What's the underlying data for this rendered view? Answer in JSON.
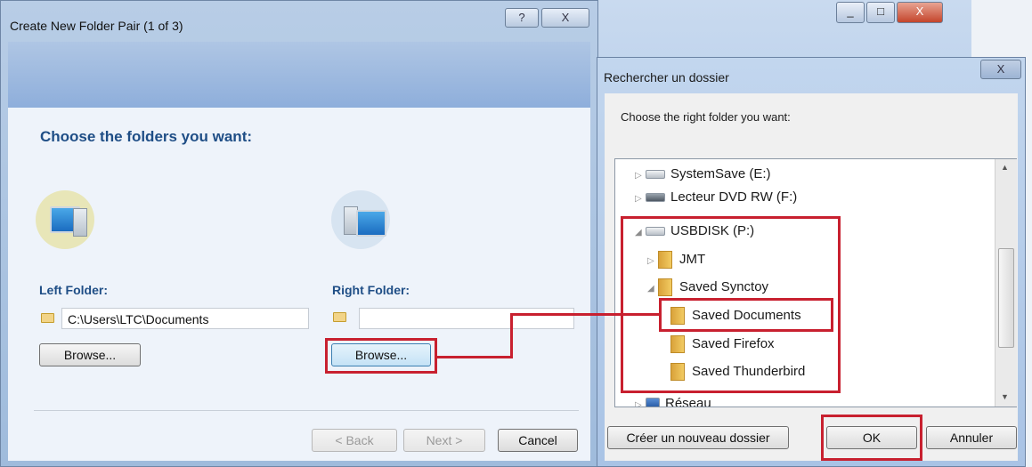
{
  "main_dialog": {
    "title": "Create New Folder Pair (1 of 3)",
    "help_symbol": "?",
    "close_symbol": "X",
    "heading": "Choose the folders you want:",
    "left_folder": {
      "label": "Left Folder:",
      "path": "C:\\Users\\LTC\\Documents",
      "browse_label": "Browse..."
    },
    "right_folder": {
      "label": "Right Folder:",
      "path": "",
      "browse_label": "Browse..."
    },
    "footer": {
      "back_label": "< Back",
      "next_label": "Next >",
      "cancel_label": "Cancel"
    }
  },
  "background_window": {
    "minimize_symbol": "_",
    "maximize_symbol": "□",
    "close_symbol": "X"
  },
  "browse_dialog": {
    "title": "Rechercher un dossier",
    "close_symbol": "X",
    "prompt": "Choose the right folder you want:",
    "tree": [
      {
        "label": "SystemSave (E:)",
        "type": "drive",
        "expand": "▷"
      },
      {
        "label": "Lecteur DVD RW (F:)",
        "type": "dvd",
        "expand": "▷"
      },
      {
        "label": "USBDISK (P:)",
        "type": "drive",
        "expand": "◢"
      },
      {
        "label": "JMT",
        "type": "folder",
        "expand": "▷"
      },
      {
        "label": "Saved Synctoy",
        "type": "folder",
        "expand": "◢"
      },
      {
        "label": "Saved Documents",
        "type": "folder",
        "expand": ""
      },
      {
        "label": "Saved Firefox",
        "type": "folder",
        "expand": ""
      },
      {
        "label": "Saved Thunderbird",
        "type": "folder",
        "expand": ""
      },
      {
        "label": "Réseau",
        "type": "network",
        "expand": "▷"
      }
    ],
    "buttons": {
      "new_folder_label": "Créer un nouveau dossier",
      "ok_label": "OK",
      "cancel_label": "Annuler"
    }
  },
  "colors": {
    "highlight": "#c8202f",
    "heading": "#1f4e86"
  }
}
